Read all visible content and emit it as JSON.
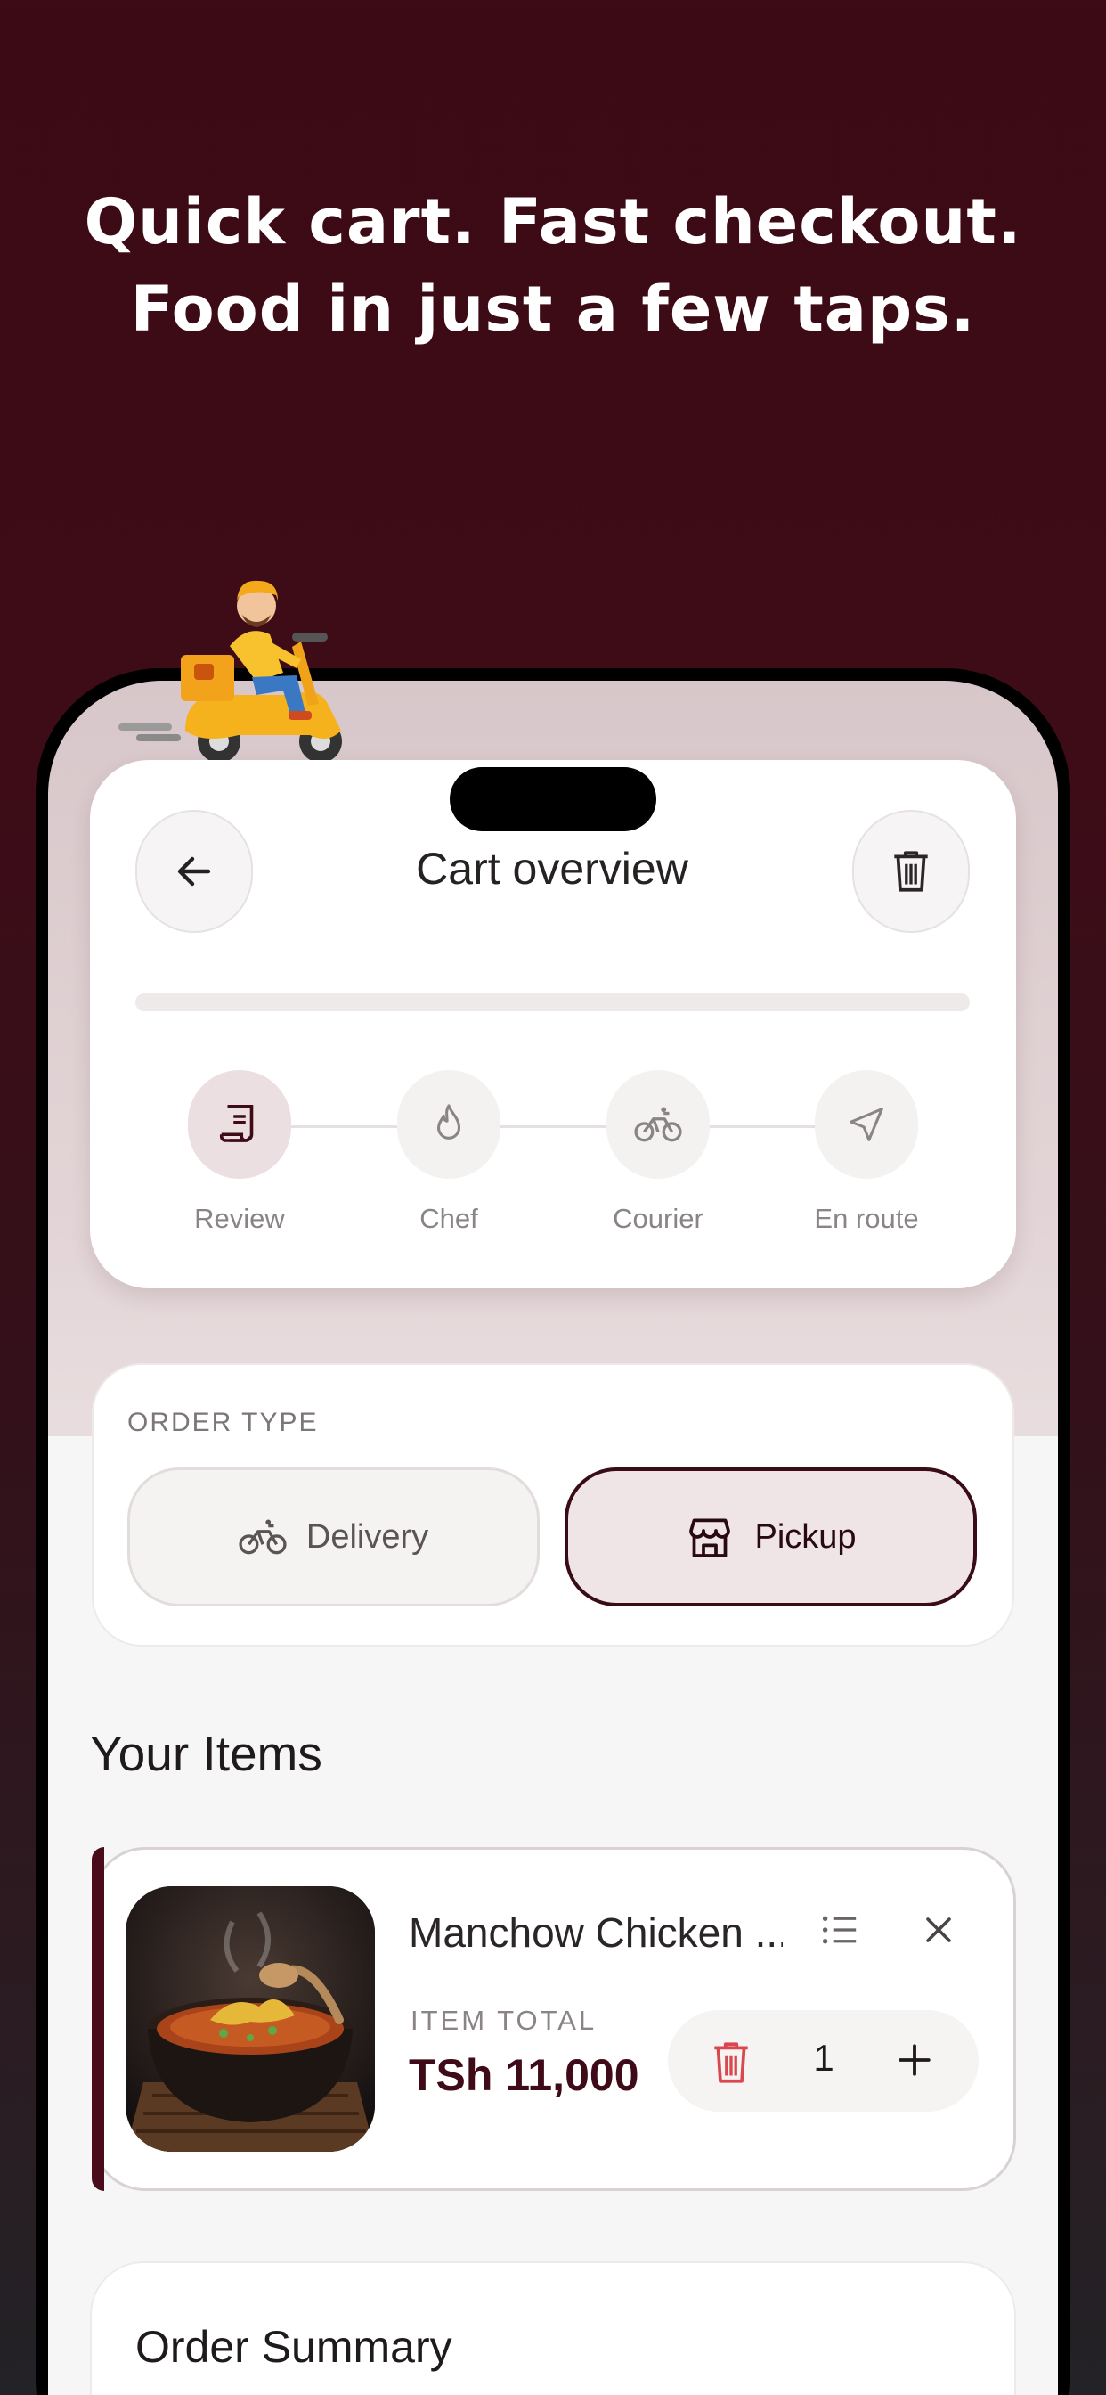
{
  "headline": {
    "line1": "Quick cart. Fast checkout.",
    "line2": "Food in just a few taps."
  },
  "header": {
    "title": "Cart overview",
    "back_icon": "arrow-left-icon",
    "delete_icon": "trash-icon"
  },
  "progress": {
    "steps": [
      {
        "label": "Review",
        "icon": "receipt-icon",
        "active": true
      },
      {
        "label": "Chef",
        "icon": "flame-icon",
        "active": false
      },
      {
        "label": "Courier",
        "icon": "bicycle-icon",
        "active": false
      },
      {
        "label": "En route",
        "icon": "navigation-icon",
        "active": false
      }
    ]
  },
  "order_type": {
    "caption": "ORDER TYPE",
    "options": [
      {
        "label": "Delivery",
        "icon": "bicycle-icon",
        "selected": false
      },
      {
        "label": "Pickup",
        "icon": "store-icon",
        "selected": true
      }
    ]
  },
  "items": {
    "heading": "Your Items",
    "list": [
      {
        "name": "Manchow Chicken ...",
        "total_caption": "ITEM TOTAL",
        "price": "TSh 11,000",
        "quantity": "1",
        "icons": [
          "list-icon",
          "close-icon",
          "trash-icon",
          "plus-icon"
        ]
      }
    ]
  },
  "summary": {
    "title": "Order Summary"
  },
  "colors": {
    "brand": "#3f0b18",
    "danger": "#d9474f",
    "background": "#3c0a14"
  }
}
